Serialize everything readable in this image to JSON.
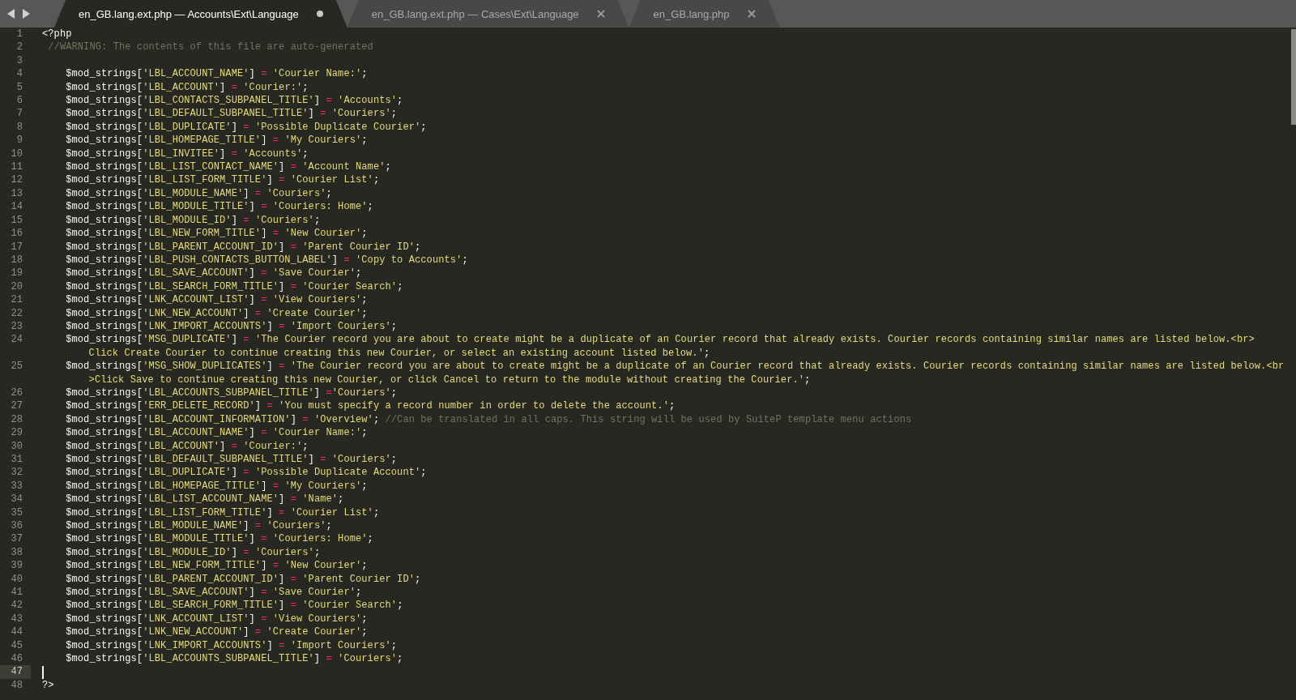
{
  "tabs": [
    {
      "label": "en_GB.lang.ext.php — Accounts\\Ext\\Language",
      "selected": true,
      "modified": true
    },
    {
      "label": "en_GB.lang.ext.php — Cases\\Ext\\Language",
      "selected": false,
      "modified": false
    },
    {
      "label": "en_GB.lang.php",
      "selected": false,
      "modified": false
    }
  ],
  "lines": [
    {
      "number": "1",
      "current": false,
      "rows": [
        "<?php"
      ]
    },
    {
      "number": "2",
      "current": false,
      "rows": [
        " //WARNING: The contents of this file are auto-generated"
      ]
    },
    {
      "number": "3",
      "current": false
    },
    {
      "number": "4",
      "current": false,
      "rows": [
        "    $mod_strings['LBL_ACCOUNT_NAME'] = 'Courier Name:';"
      ]
    },
    {
      "number": "5",
      "current": false,
      "rows": [
        "    $mod_strings['LBL_ACCOUNT'] = 'Courier:';"
      ]
    },
    {
      "number": "6",
      "current": false,
      "rows": [
        "    $mod_strings['LBL_CONTACTS_SUBPANEL_TITLE'] = 'Accounts';"
      ]
    },
    {
      "number": "7",
      "current": false,
      "rows": [
        "    $mod_strings['LBL_DEFAULT_SUBPANEL_TITLE'] = 'Couriers';"
      ]
    },
    {
      "number": "8",
      "current": false,
      "rows": [
        "    $mod_strings['LBL_DUPLICATE'] = 'Possible Duplicate Courier';"
      ]
    },
    {
      "number": "9",
      "current": false,
      "rows": [
        "    $mod_strings['LBL_HOMEPAGE_TITLE'] = 'My Couriers';"
      ]
    },
    {
      "number": "10",
      "current": false,
      "rows": [
        "    $mod_strings['LBL_INVITEE'] = 'Accounts';"
      ]
    },
    {
      "number": "11",
      "current": false,
      "rows": [
        "    $mod_strings['LBL_LIST_CONTACT_NAME'] = 'Account Name';"
      ]
    },
    {
      "number": "12",
      "current": false,
      "rows": [
        "    $mod_strings['LBL_LIST_FORM_TITLE'] = 'Courier List';"
      ]
    },
    {
      "number": "13",
      "current": false,
      "rows": [
        "    $mod_strings['LBL_MODULE_NAME'] = 'Couriers';"
      ]
    },
    {
      "number": "14",
      "current": false,
      "rows": [
        "    $mod_strings['LBL_MODULE_TITLE'] = 'Couriers: Home';"
      ]
    },
    {
      "number": "15",
      "current": false,
      "rows": [
        "    $mod_strings['LBL_MODULE_ID'] = 'Couriers';"
      ]
    },
    {
      "number": "16",
      "current": false,
      "rows": [
        "    $mod_strings['LBL_NEW_FORM_TITLE'] = 'New Courier';"
      ]
    },
    {
      "number": "17",
      "current": false,
      "rows": [
        "    $mod_strings['LBL_PARENT_ACCOUNT_ID'] = 'Parent Courier ID';"
      ]
    },
    {
      "number": "18",
      "current": false,
      "rows": [
        "    $mod_strings['LBL_PUSH_CONTACTS_BUTTON_LABEL'] = 'Copy to Accounts';"
      ]
    },
    {
      "number": "19",
      "current": false,
      "rows": [
        "    $mod_strings['LBL_SAVE_ACCOUNT'] = 'Save Courier';"
      ]
    },
    {
      "number": "20",
      "current": false,
      "rows": [
        "    $mod_strings['LBL_SEARCH_FORM_TITLE'] = 'Courier Search';"
      ]
    },
    {
      "number": "21",
      "current": false,
      "rows": [
        "    $mod_strings['LNK_ACCOUNT_LIST'] = 'View Couriers';"
      ]
    },
    {
      "number": "22",
      "current": false,
      "rows": [
        "    $mod_strings['LNK_NEW_ACCOUNT'] = 'Create Courier';"
      ]
    },
    {
      "number": "23",
      "current": false,
      "rows": [
        "    $mod_strings['LNK_IMPORT_ACCOUNTS'] = 'Import Couriers';"
      ]
    },
    {
      "number": "24",
      "current": false,
      "rows": [
        "    $mod_strings['MSG_DUPLICATE'] = 'The Courier record you are about to create might be a duplicate of an Courier record that already exists. Courier records containing similar names are listed below.<br>",
        "Click Create Courier to continue creating this new Courier, or select an existing account listed below.';"
      ]
    },
    {
      "number": "25",
      "current": false,
      "rows": [
        "    $mod_strings['MSG_SHOW_DUPLICATES'] = 'The Courier record you are about to create might be a duplicate of an Courier record that already exists. Courier records containing similar names are listed below.<br",
        ">Click Save to continue creating this new Courier, or click Cancel to return to the module without creating the Courier.';"
      ]
    },
    {
      "number": "26",
      "current": false,
      "rows": [
        "    $mod_strings['LBL_ACCOUNTS_SUBPANEL_TITLE'] ='Couriers';"
      ]
    },
    {
      "number": "27",
      "current": false,
      "rows": [
        "    $mod_strings['ERR_DELETE_RECORD'] = 'You must specify a record number in order to delete the account.';"
      ]
    },
    {
      "number": "28",
      "current": false,
      "rows": [
        "    $mod_strings['LBL_ACCOUNT_INFORMATION'] = 'Overview'; //Can be translated in all caps. This string will be used by SuiteP template menu actions"
      ]
    },
    {
      "number": "29",
      "current": false,
      "rows": [
        "    $mod_strings['LBL_ACCOUNT_NAME'] = 'Courier Name:';"
      ]
    },
    {
      "number": "30",
      "current": false,
      "rows": [
        "    $mod_strings['LBL_ACCOUNT'] = 'Courier:';"
      ]
    },
    {
      "number": "31",
      "current": false,
      "rows": [
        "    $mod_strings['LBL_DEFAULT_SUBPANEL_TITLE'] = 'Couriers';"
      ]
    },
    {
      "number": "32",
      "current": false,
      "rows": [
        "    $mod_strings['LBL_DUPLICATE'] = 'Possible Duplicate Account';"
      ]
    },
    {
      "number": "33",
      "current": false,
      "rows": [
        "    $mod_strings['LBL_HOMEPAGE_TITLE'] = 'My Couriers';"
      ]
    },
    {
      "number": "34",
      "current": false,
      "rows": [
        "    $mod_strings['LBL_LIST_ACCOUNT_NAME'] = 'Name';"
      ]
    },
    {
      "number": "35",
      "current": false,
      "rows": [
        "    $mod_strings['LBL_LIST_FORM_TITLE'] = 'Courier List';"
      ]
    },
    {
      "number": "36",
      "current": false,
      "rows": [
        "    $mod_strings['LBL_MODULE_NAME'] = 'Couriers';"
      ]
    },
    {
      "number": "37",
      "current": false,
      "rows": [
        "    $mod_strings['LBL_MODULE_TITLE'] = 'Couriers: Home';"
      ]
    },
    {
      "number": "38",
      "current": false,
      "rows": [
        "    $mod_strings['LBL_MODULE_ID'] = 'Couriers';"
      ]
    },
    {
      "number": "39",
      "current": false,
      "rows": [
        "    $mod_strings['LBL_NEW_FORM_TITLE'] = 'New Courier';"
      ]
    },
    {
      "number": "40",
      "current": false,
      "rows": [
        "    $mod_strings['LBL_PARENT_ACCOUNT_ID'] = 'Parent Courier ID';"
      ]
    },
    {
      "number": "41",
      "current": false,
      "rows": [
        "    $mod_strings['LBL_SAVE_ACCOUNT'] = 'Save Courier';"
      ]
    },
    {
      "number": "42",
      "current": false,
      "rows": [
        "    $mod_strings['LBL_SEARCH_FORM_TITLE'] = 'Courier Search';"
      ]
    },
    {
      "number": "43",
      "current": false,
      "rows": [
        "    $mod_strings['LNK_ACCOUNT_LIST'] = 'View Couriers';"
      ]
    },
    {
      "number": "44",
      "current": false,
      "rows": [
        "    $mod_strings['LNK_NEW_ACCOUNT'] = 'Create Courier';"
      ]
    },
    {
      "number": "45",
      "current": false,
      "rows": [
        "    $mod_strings['LNK_IMPORT_ACCOUNTS'] = 'Import Couriers';"
      ]
    },
    {
      "number": "46",
      "current": false,
      "rows": [
        "    $mod_strings['LBL_ACCOUNTS_SUBPANEL_TITLE'] = 'Couriers';"
      ]
    },
    {
      "number": "47",
      "current": true
    },
    {
      "number": "48",
      "current": false,
      "rows": [
        "?>"
      ]
    }
  ]
}
